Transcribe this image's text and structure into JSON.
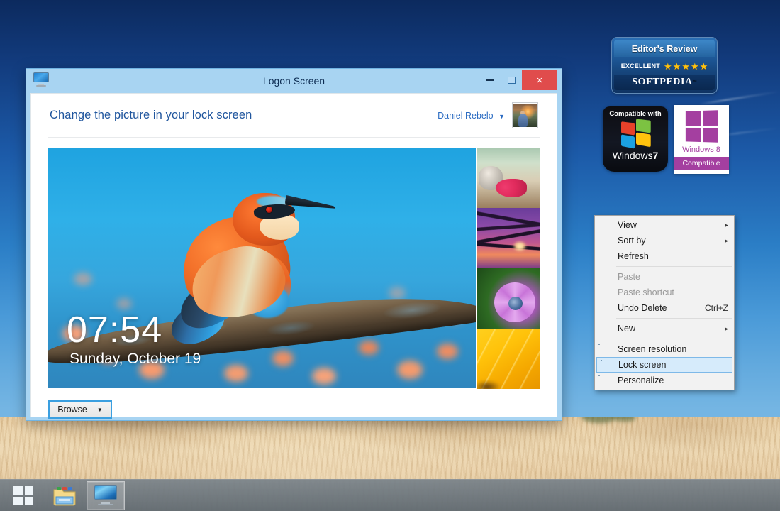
{
  "window": {
    "title": "Logon Screen",
    "icon": "monitor-icon",
    "controls": {
      "minimize": "–",
      "maximize": "□",
      "close": "×"
    },
    "heading": "Change the picture in your lock screen",
    "user": {
      "name": "Daniel Rebelo",
      "caret": "▼",
      "avatar": "user-photo"
    },
    "preview": {
      "clock_time": "07:54",
      "clock_date": "Sunday, October 19",
      "image_alt": "bee-eater bird on branch"
    },
    "thumbnails": [
      {
        "name": "zen-stones-pink-flowers"
      },
      {
        "name": "purple-cattails-sunset"
      },
      {
        "name": "purple-daisy"
      },
      {
        "name": "yellow-flower-petal"
      }
    ],
    "browse": {
      "label": "Browse",
      "caret": "▼"
    }
  },
  "context_menu": {
    "items": [
      {
        "label": "View",
        "arrow": "▸",
        "accel": "",
        "state": "normal",
        "icon": ""
      },
      {
        "label": "Sort by",
        "arrow": "▸",
        "accel": "",
        "state": "normal",
        "icon": ""
      },
      {
        "label": "Refresh",
        "arrow": "",
        "accel": "",
        "state": "normal",
        "icon": ""
      },
      {
        "label": "Paste",
        "arrow": "",
        "accel": "",
        "state": "disabled",
        "icon": ""
      },
      {
        "label": "Paste shortcut",
        "arrow": "",
        "accel": "",
        "state": "disabled",
        "icon": ""
      },
      {
        "label": "Undo Delete",
        "arrow": "",
        "accel": "Ctrl+Z",
        "state": "normal",
        "icon": ""
      },
      {
        "label": "New",
        "arrow": "▸",
        "accel": "",
        "state": "normal",
        "icon": ""
      },
      {
        "label": "Screen resolution",
        "arrow": "",
        "accel": "",
        "state": "normal",
        "icon": "monitor-green-icon"
      },
      {
        "label": "Lock screen",
        "arrow": "",
        "accel": "",
        "state": "selected",
        "icon": "monitor-blue-icon"
      },
      {
        "label": "Personalize",
        "arrow": "",
        "accel": "",
        "state": "normal",
        "icon": "monitor-brush-icon"
      }
    ]
  },
  "badges": {
    "softpedia": {
      "title": "Editor's Review",
      "rating_label": "EXCELLENT",
      "stars": 5,
      "brand": "SOFTPEDIA",
      "trademark": "™"
    },
    "windows7": {
      "top": "Compatible with",
      "name": "Windows",
      "version": "7"
    },
    "windows8": {
      "name": "Windows 8",
      "status": "Compatible"
    }
  },
  "taskbar": {
    "items": [
      {
        "name": "start-button",
        "icon": "windows-flag-icon"
      },
      {
        "name": "file-explorer",
        "icon": "folder-icon"
      },
      {
        "name": "logon-screen-task",
        "icon": "monitor-icon",
        "active": true
      }
    ]
  },
  "colors": {
    "accent_blue": "#2a6bc2",
    "heading_blue": "#20569e",
    "close_red": "#e04c4c",
    "window_frame": "#a8d4f2",
    "menu_selected": "#d6ebfb",
    "star_gold": "#ffc20e"
  }
}
